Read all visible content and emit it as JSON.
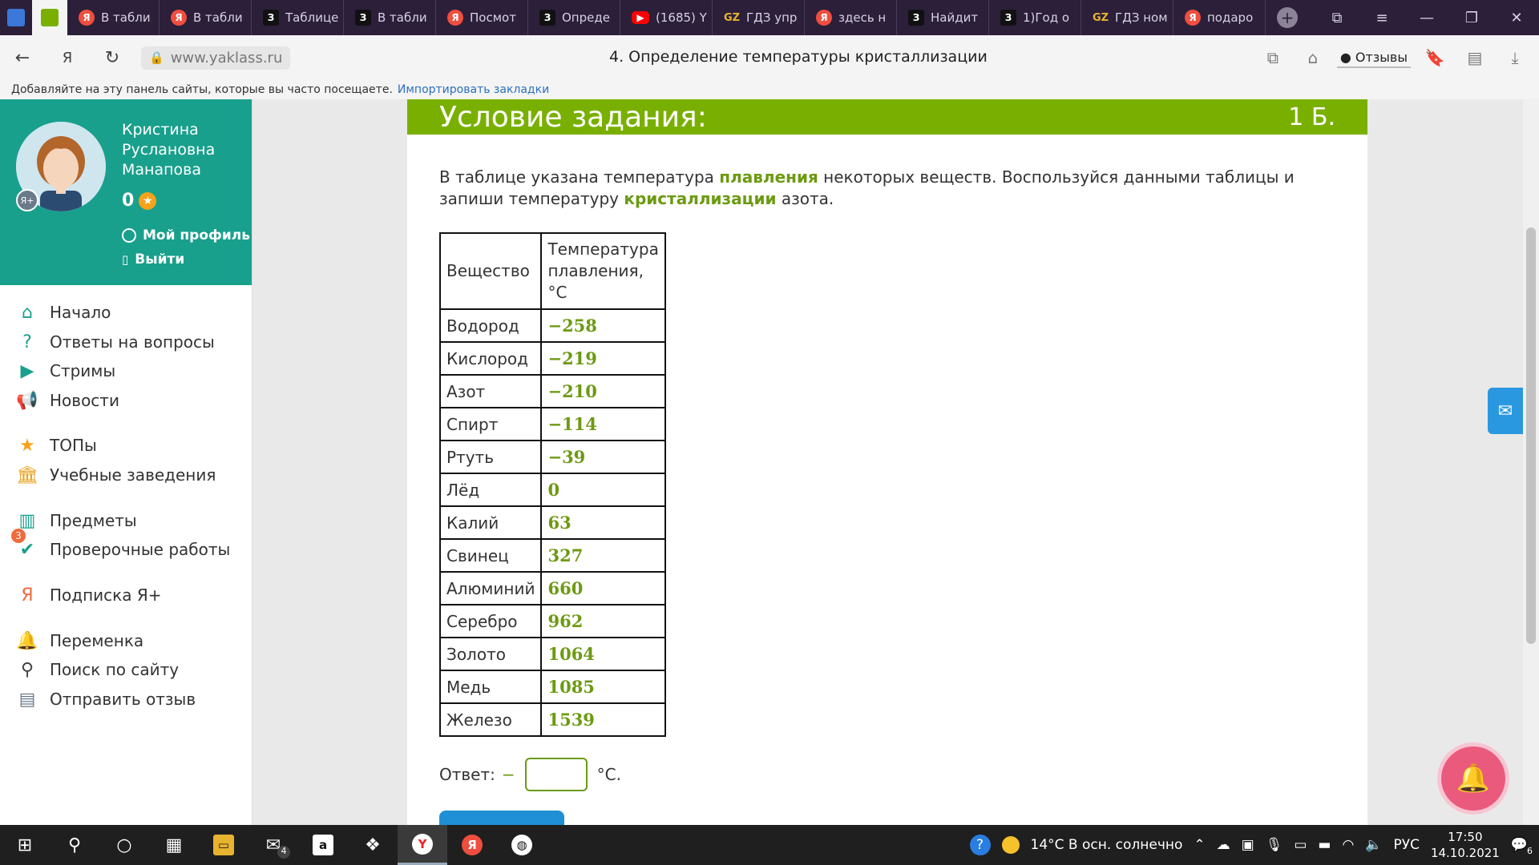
{
  "browser": {
    "tabs": [
      {
        "icon": "yandex-icon",
        "label": "В табли"
      },
      {
        "icon": "yandex-icon",
        "label": "В табли"
      },
      {
        "icon": "znanija-icon",
        "label": "Таблице"
      },
      {
        "icon": "znanija-icon",
        "label": "В табли"
      },
      {
        "icon": "yandex-icon",
        "label": "Посмот"
      },
      {
        "icon": "znanija-icon",
        "label": "Опреде"
      },
      {
        "icon": "youtube-icon",
        "label": "(1685) Y"
      },
      {
        "icon": "gdz-icon",
        "label": "ГДЗ упр"
      },
      {
        "icon": "yandex-icon",
        "label": "здесь н"
      },
      {
        "icon": "znanija-icon",
        "label": "Найдит"
      },
      {
        "icon": "znanija-icon",
        "label": "1)Год о"
      },
      {
        "icon": "gdz-icon",
        "label": "ГДЗ ном"
      },
      {
        "icon": "yandex-icon",
        "label": "подаро"
      }
    ],
    "url": "www.yaklass.ru",
    "page_title": "4. Определение температуры кристаллизации",
    "feedback_label": "Отзывы",
    "bookmarks_hint": "Добавляйте на эту панель сайты, которые вы часто посещаете.",
    "import_bookmarks": "Импортировать закладки"
  },
  "profile": {
    "name": "Кристина Руслановна Манапова",
    "points": "0",
    "my_profile": "Мой профиль",
    "logout": "Выйти"
  },
  "menu": [
    {
      "label": "Начало",
      "icon": "home-icon"
    },
    {
      "label": "Ответы на вопросы",
      "icon": "question-icon"
    },
    {
      "label": "Стримы",
      "icon": "play-icon"
    },
    {
      "label": "Новости",
      "icon": "megaphone-icon"
    },
    {
      "label": "ТОПы",
      "icon": "star-icon"
    },
    {
      "label": "Учебные заведения",
      "icon": "school-icon"
    },
    {
      "label": "Предметы",
      "icon": "book-icon"
    },
    {
      "label": "Проверочные работы",
      "icon": "check-icon",
      "badge": "3"
    },
    {
      "label": "Подписка Я+",
      "icon": "subscription-icon"
    },
    {
      "label": "Переменка",
      "icon": "bell-icon"
    },
    {
      "label": "Поиск по сайту",
      "icon": "search-icon"
    },
    {
      "label": "Отправить отзыв",
      "icon": "comment-icon"
    }
  ],
  "task": {
    "heading": "Условие задания:",
    "points": "1 Б.",
    "text_1": "В таблице указана температура ",
    "keyword_1": "плавления",
    "text_2": " некоторых веществ. Воспользуйся данными таблицы и запиши температуру ",
    "keyword_2": "кристаллизации",
    "text_3": " азота.",
    "table_headers": [
      "Вещество",
      "Температура плавления, °С"
    ],
    "table_rows": [
      [
        "Водород",
        "−258"
      ],
      [
        "Кислород",
        "−219"
      ],
      [
        "Азот",
        "−210"
      ],
      [
        "Спирт",
        "−114"
      ],
      [
        "Ртуть",
        "−39"
      ],
      [
        "Лёд",
        "0"
      ],
      [
        "Калий",
        "63"
      ],
      [
        "Свинец",
        "327"
      ],
      [
        "Алюминий",
        "660"
      ],
      [
        "Серебро",
        "962"
      ],
      [
        "Золото",
        "1064"
      ],
      [
        "Медь",
        "1085"
      ],
      [
        "Железо",
        "1539"
      ]
    ],
    "answer_label": "Ответ:",
    "answer_sign": "−",
    "answer_value": "",
    "answer_unit": "°С."
  },
  "taskbar": {
    "weather": "14°C  В осн. солнечно",
    "lang": "РУС",
    "time": "17:50",
    "date": "14.10.2021",
    "notifications": "6",
    "mail_badge": "4"
  }
}
